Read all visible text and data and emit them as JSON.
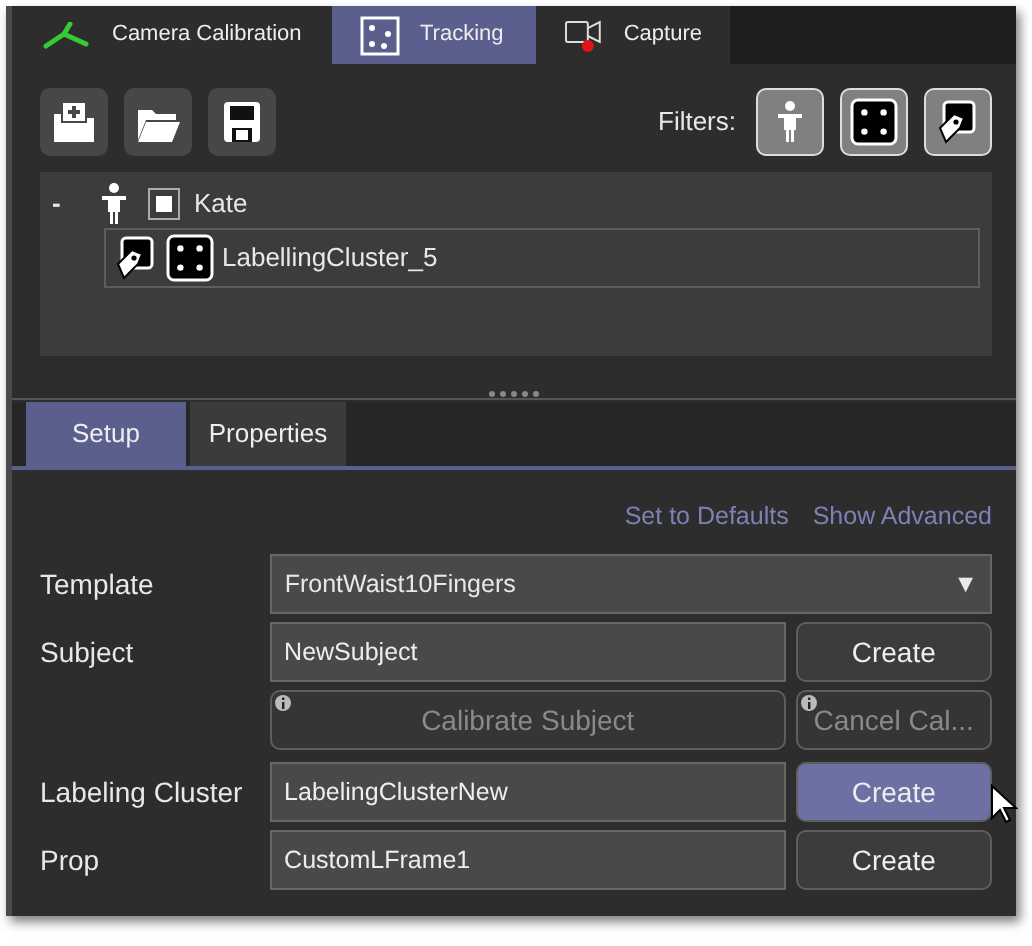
{
  "top_tabs": [
    {
      "label": "Camera Calibration",
      "selected": false
    },
    {
      "label": "Tracking",
      "selected": true
    },
    {
      "label": "Capture",
      "selected": false
    }
  ],
  "toolbar": {
    "filters_label": "Filters:"
  },
  "tree": {
    "items": [
      {
        "toggle": "-",
        "label": "Kate",
        "checked": true,
        "children": [
          {
            "label": "LabellingCluster_5",
            "selected": true
          }
        ]
      }
    ]
  },
  "panel_tabs": [
    {
      "label": "Setup",
      "selected": true
    },
    {
      "label": "Properties",
      "selected": false
    }
  ],
  "links": [
    "Set to Defaults",
    "Show Advanced"
  ],
  "form_rows": [
    {
      "kind": "select",
      "label": "Template",
      "value": "FrontWaist10Fingers",
      "caret": "▼"
    },
    {
      "kind": "input",
      "label": "Subject",
      "value": "NewSubject",
      "button": {
        "label": "Create",
        "hovered": false
      }
    },
    {
      "kind": "actions",
      "buttons": [
        {
          "label": "Calibrate Subject",
          "disabled": true
        },
        {
          "label": "Cancel Cal...",
          "disabled": true
        }
      ]
    },
    {
      "kind": "input",
      "label": "Labeling Cluster",
      "value": "LabelingClusterNew",
      "button": {
        "label": "Create",
        "hovered": true
      }
    },
    {
      "kind": "input",
      "label": "Prop",
      "value": "CustomLFrame1",
      "button": {
        "label": "Create",
        "hovered": false
      }
    }
  ]
}
